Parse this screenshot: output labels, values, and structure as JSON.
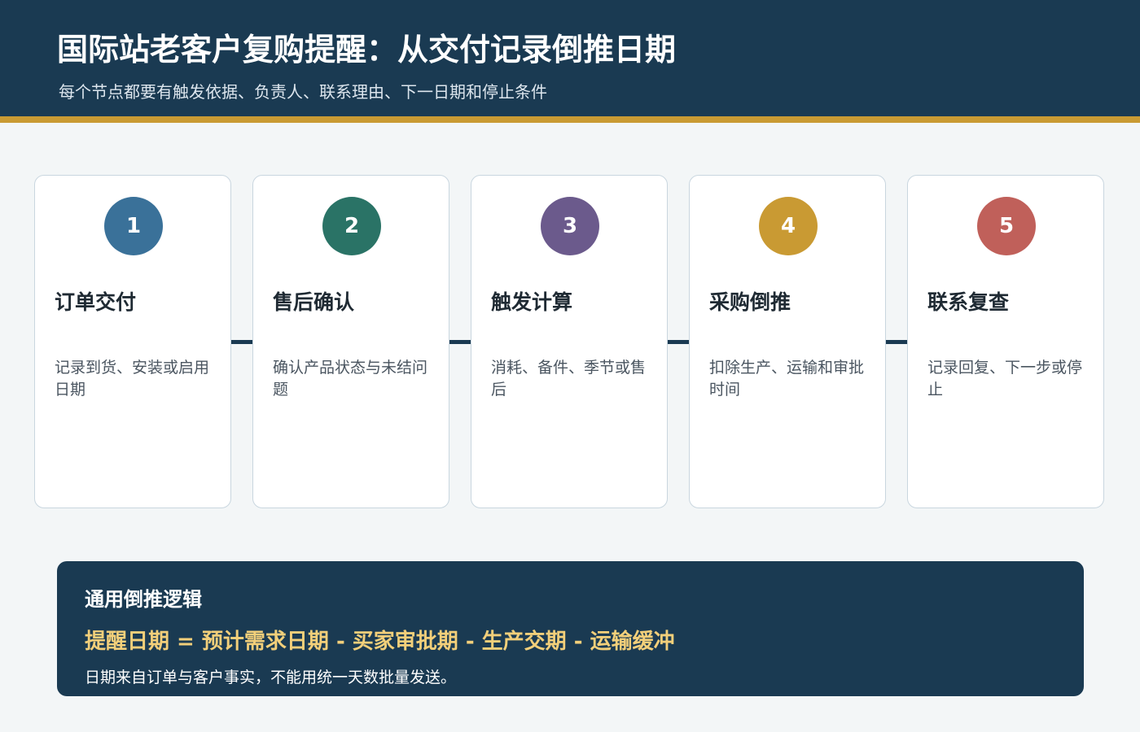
{
  "header": {
    "title": "国际站老客户复购提醒：从交付记录倒推日期",
    "subtitle": "每个节点都要有触发依据、负责人、联系理由、下一日期和停止条件"
  },
  "colors": {
    "header_bg": "#1a3a52",
    "accent_gold": "#c99a33",
    "formula_highlight": "#f2cf7a"
  },
  "steps": [
    {
      "number": "1",
      "title": "订单交付",
      "description": "记录到货、安装或启用日期",
      "color": "#3a7199"
    },
    {
      "number": "2",
      "title": "售后确认",
      "description": "确认产品状态与未结问题",
      "color": "#2a7366"
    },
    {
      "number": "3",
      "title": "触发计算",
      "description": "消耗、备件、季节或售后",
      "color": "#6b5a8c"
    },
    {
      "number": "4",
      "title": "采购倒推",
      "description": "扣除生产、运输和审批时间",
      "color": "#c99a33"
    },
    {
      "number": "5",
      "title": "联系复查",
      "description": "记录回复、下一步或停止",
      "color": "#c0605a"
    }
  ],
  "formula": {
    "heading": "通用倒推逻辑",
    "expression": "提醒日期 = 预计需求日期 - 买家审批期 - 生产交期 - 运输缓冲",
    "note": "日期来自订单与客户事实，不能用统一天数批量发送。"
  }
}
